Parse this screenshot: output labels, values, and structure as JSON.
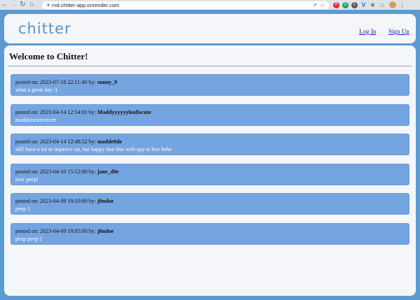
{
  "browser": {
    "url": "md-chitter-app.onrender.com"
  },
  "header": {
    "logo": "chitter",
    "login_label": "Log In",
    "signup_label": "Sign Up"
  },
  "main": {
    "title": "Welcome to Chitter!",
    "posted_on_label": "posted on:",
    "by_label": "by:",
    "peeps": [
      {
        "timestamp": "2023-07-18 22:11:40",
        "user": "sunny_9",
        "text": "what a great day :)"
      },
      {
        "timestamp": "2023-04-14 12:54:01",
        "user": "Maddyyyyyyloofiscute",
        "text": "maddyiscutececee"
      },
      {
        "timestamp": "2023-04-14 12:48:52",
        "user": "madde0de",
        "text": "still have a lot to improve on, but happy that this web-app is live hehe"
      },
      {
        "timestamp": "2023-04-10 15:12:00",
        "user": "jane_d0e",
        "text": "new peep!"
      },
      {
        "timestamp": "2023-04-09 19:10:00",
        "user": "j0ndoe",
        "text": "peep 1"
      },
      {
        "timestamp": "2023-04-09 19:05:00",
        "user": "j0ndoe",
        "text": "peep peep 2"
      }
    ]
  },
  "colors": {
    "background": "#5b9bd0",
    "card": "#f5f6fa",
    "peep": "#75a5e0",
    "logo": "#5a94c5"
  }
}
